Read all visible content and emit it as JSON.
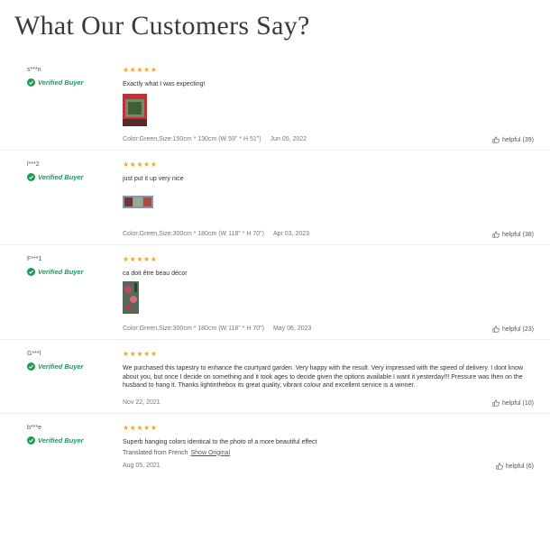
{
  "header": {
    "title": "What Our Customers Say?"
  },
  "verified_label": "Verified Buyer",
  "colors": {
    "verified": "#1d9a5a",
    "star": "#f5a623"
  },
  "reviews": [
    {
      "name": "s***n",
      "stars": "★★★★★",
      "rating": 5,
      "text": "Exactly what I was expecting!",
      "meta": "Color:Green,Size:150cm * 130cm (W 59\" * H 51\")",
      "date": "Jun 05, 2022",
      "helpful": "helpful (39)"
    },
    {
      "name": "l***2",
      "stars": "★★★★★",
      "rating": 5,
      "text": "just put it up very nice",
      "meta": "Color:Green,Size:300cm * 180cm (W 118\" * H 70\")",
      "date": "Apr 03, 2023",
      "helpful": "helpful (38)"
    },
    {
      "name": "F***1",
      "stars": "★★★★★",
      "rating": 5,
      "text": "ca doit être beau décor",
      "meta": "Color:Green,Size:300cm * 180cm (W 118\" * H 70\")",
      "date": "May 06, 2023",
      "helpful": "helpful (23)"
    },
    {
      "name": "G***l",
      "stars": "★★★★★",
      "rating": 5,
      "text": "We purchased this tapestry to enhance the courtyard garden. Very happy with the result. Very impressed with the speed of delivery. I dont know about you, but once I decide on something and it took ages to decide given the options available I want it yesterday!!! Pressure was then on the husband to hang it. Thanks lightinthebox its great quality, vibrant colour and excellent service is a winner.",
      "date": "Nov 22, 2021",
      "helpful": "helpful (10)"
    },
    {
      "name": "b***e",
      "stars": "★★★★★",
      "rating": 5,
      "text": "Superb hanging colors identical to the photo of a more beautiful effect",
      "translated": "Translated from French",
      "show_original": "Show Original",
      "date": "Aug 05, 2021",
      "helpful": "helpful (6)"
    }
  ]
}
